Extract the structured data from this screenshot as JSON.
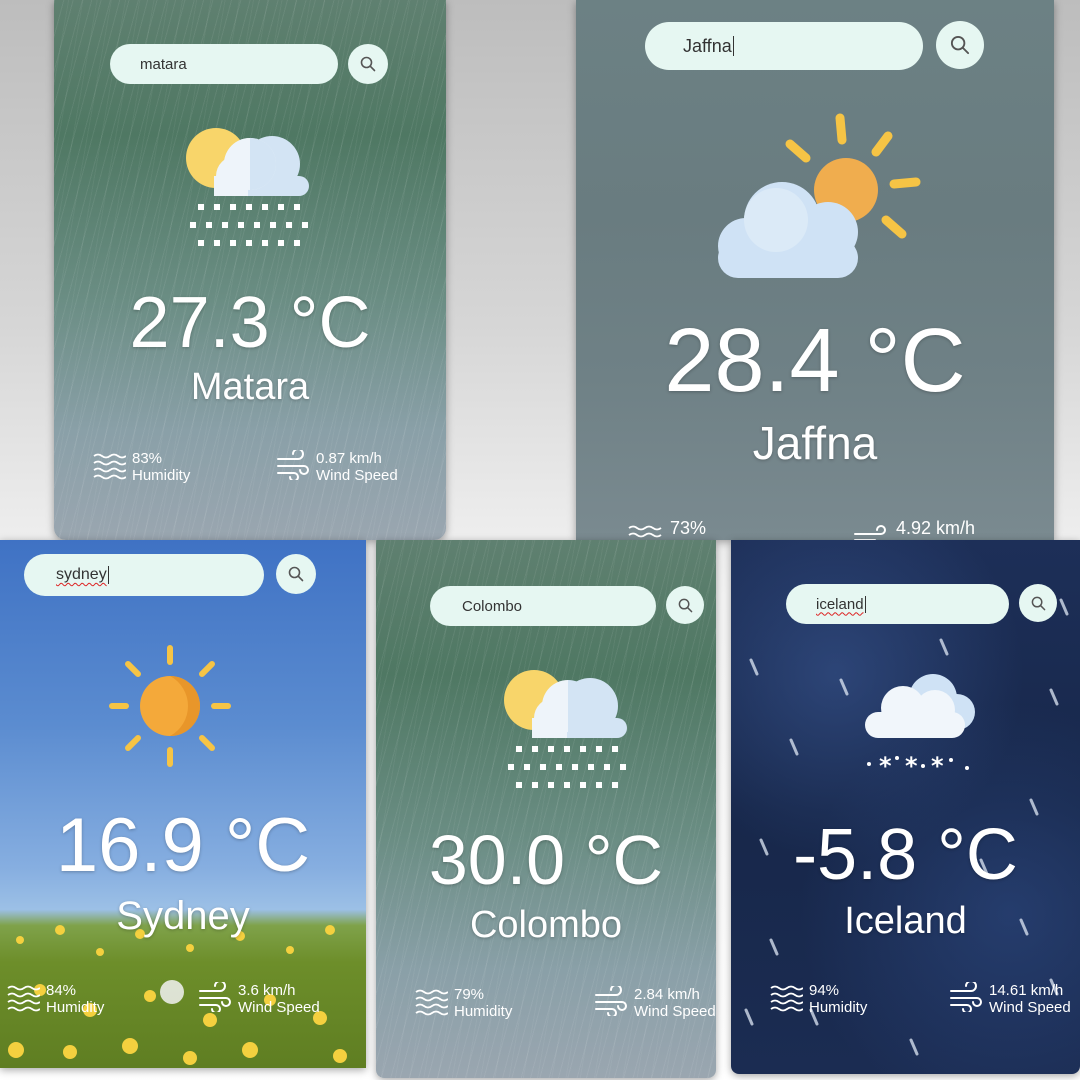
{
  "cards": [
    {
      "city": "Matara",
      "search_value": "matara",
      "temperature": "27.3 °C",
      "humidity": "83%",
      "humidity_label": "Humidity",
      "wind": "0.87 km/h",
      "wind_label": "Wind Speed",
      "weather_icon": "sun-cloud-rain-icon"
    },
    {
      "city": "Jaffna",
      "search_value": "Jaffna",
      "temperature": "28.4 °C",
      "humidity": "73%",
      "wind": "4.92 km/h",
      "weather_icon": "sun-behind-cloud-icon"
    },
    {
      "city": "Sydney",
      "search_value": "sydney",
      "temperature": "16.9 °C",
      "humidity": "84%",
      "humidity_label": "Humidity",
      "wind": "3.6 km/h",
      "wind_label": "Wind Speed",
      "weather_icon": "sun-icon"
    },
    {
      "city": "Colombo",
      "search_value": "Colombo",
      "temperature": "30.0 °C",
      "humidity": "79%",
      "humidity_label": "Humidity",
      "wind": "2.84 km/h",
      "wind_label": "Wind Speed",
      "weather_icon": "sun-cloud-rain-icon"
    },
    {
      "city": "Iceland",
      "search_value": "iceland",
      "temperature": "-5.8 °C",
      "humidity": "94%",
      "humidity_label": "Humidity",
      "wind": "14.61 km/h",
      "wind_label": "Wind Speed",
      "weather_icon": "cloud-snow-icon"
    }
  ],
  "icons": {
    "search": "search-icon",
    "humidity": "waves-icon",
    "wind": "wind-icon"
  },
  "colors": {
    "search_bg": "#e6f7f2",
    "sun": "#f6c445",
    "sun_orange": "#f0ad4e",
    "cloud": "#dbeaf7",
    "text": "#ffffff"
  }
}
